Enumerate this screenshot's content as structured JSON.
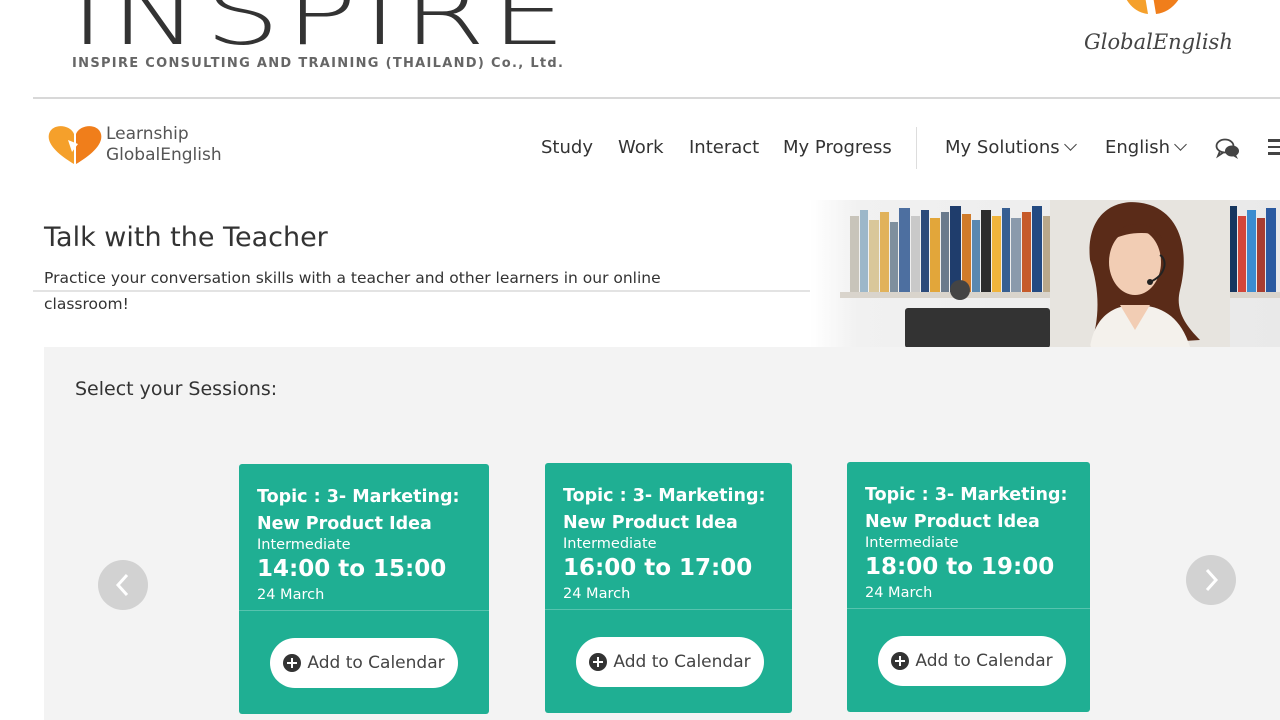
{
  "banner": {
    "brand_text": "INSPIRE",
    "brand_sub": "INSPIRE CONSULTING AND TRAINING (THAILAND) Co., Ltd.",
    "partner": "GlobalEnglish"
  },
  "nav": {
    "logo_line1": "Learnship",
    "logo_line2": "GlobalEnglish",
    "items": [
      "Study",
      "Work",
      "Interact",
      "My Progress"
    ],
    "solutions": "My Solutions",
    "language": "English",
    "icons": {
      "chat": "chat-bubbles-icon",
      "menu": "hamburger-menu-icon"
    }
  },
  "hero": {
    "title": "Talk with the Teacher",
    "description": "Practice your conversation skills with a teacher and other learners in our online classroom!"
  },
  "sessions": {
    "label": "Select your Sessions:",
    "cards": [
      {
        "topic": "Topic : 3- Marketing: New Product Idea",
        "level": "Intermediate",
        "time": "14:00 to 15:00",
        "date": "24 March",
        "button": "Add to Calendar"
      },
      {
        "topic": "Topic : 3- Marketing: New Product Idea",
        "level": "Intermediate",
        "time": "16:00 to 17:00",
        "date": "24 March",
        "button": "Add to Calendar"
      },
      {
        "topic": "Topic : 3- Marketing: New Product Idea",
        "level": "Intermediate",
        "time": "18:00 to 19:00",
        "date": "24 March",
        "button": "Add to Calendar"
      }
    ]
  },
  "colors": {
    "card": "#1faf93",
    "accent_orange": "#f5a02b",
    "panel": "#f3f3f3"
  }
}
